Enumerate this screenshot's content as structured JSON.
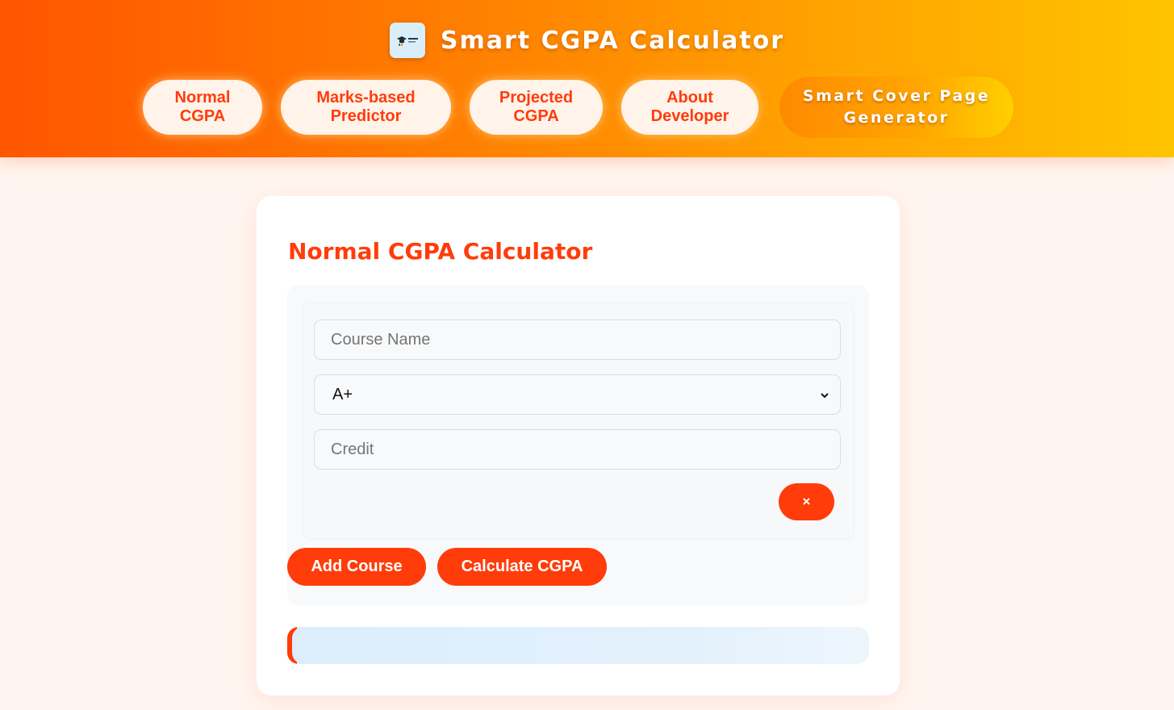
{
  "header": {
    "title": "Smart CGPA Calculator",
    "logo_icon": "graduation-cap-logo-icon"
  },
  "nav": {
    "items": [
      {
        "label": "Normal\nCGPA"
      },
      {
        "label": "Marks-based\nPredictor"
      },
      {
        "label": "Projected\nCGPA"
      },
      {
        "label": "About\nDeveloper"
      },
      {
        "label": "Smart Cover Page\nGenerator"
      }
    ]
  },
  "calculator": {
    "title": "Normal CGPA Calculator",
    "course_name_placeholder": "Course Name",
    "grade_selected": "A+",
    "credit_placeholder": "Credit",
    "remove_label": "×",
    "add_course_label": "Add Course",
    "calculate_label": "Calculate CGPA",
    "result_text": ""
  },
  "colors": {
    "accent": "#ff3c0a",
    "header_start": "#ff5500",
    "header_end": "#ffc400",
    "background": "#fff5f0"
  }
}
